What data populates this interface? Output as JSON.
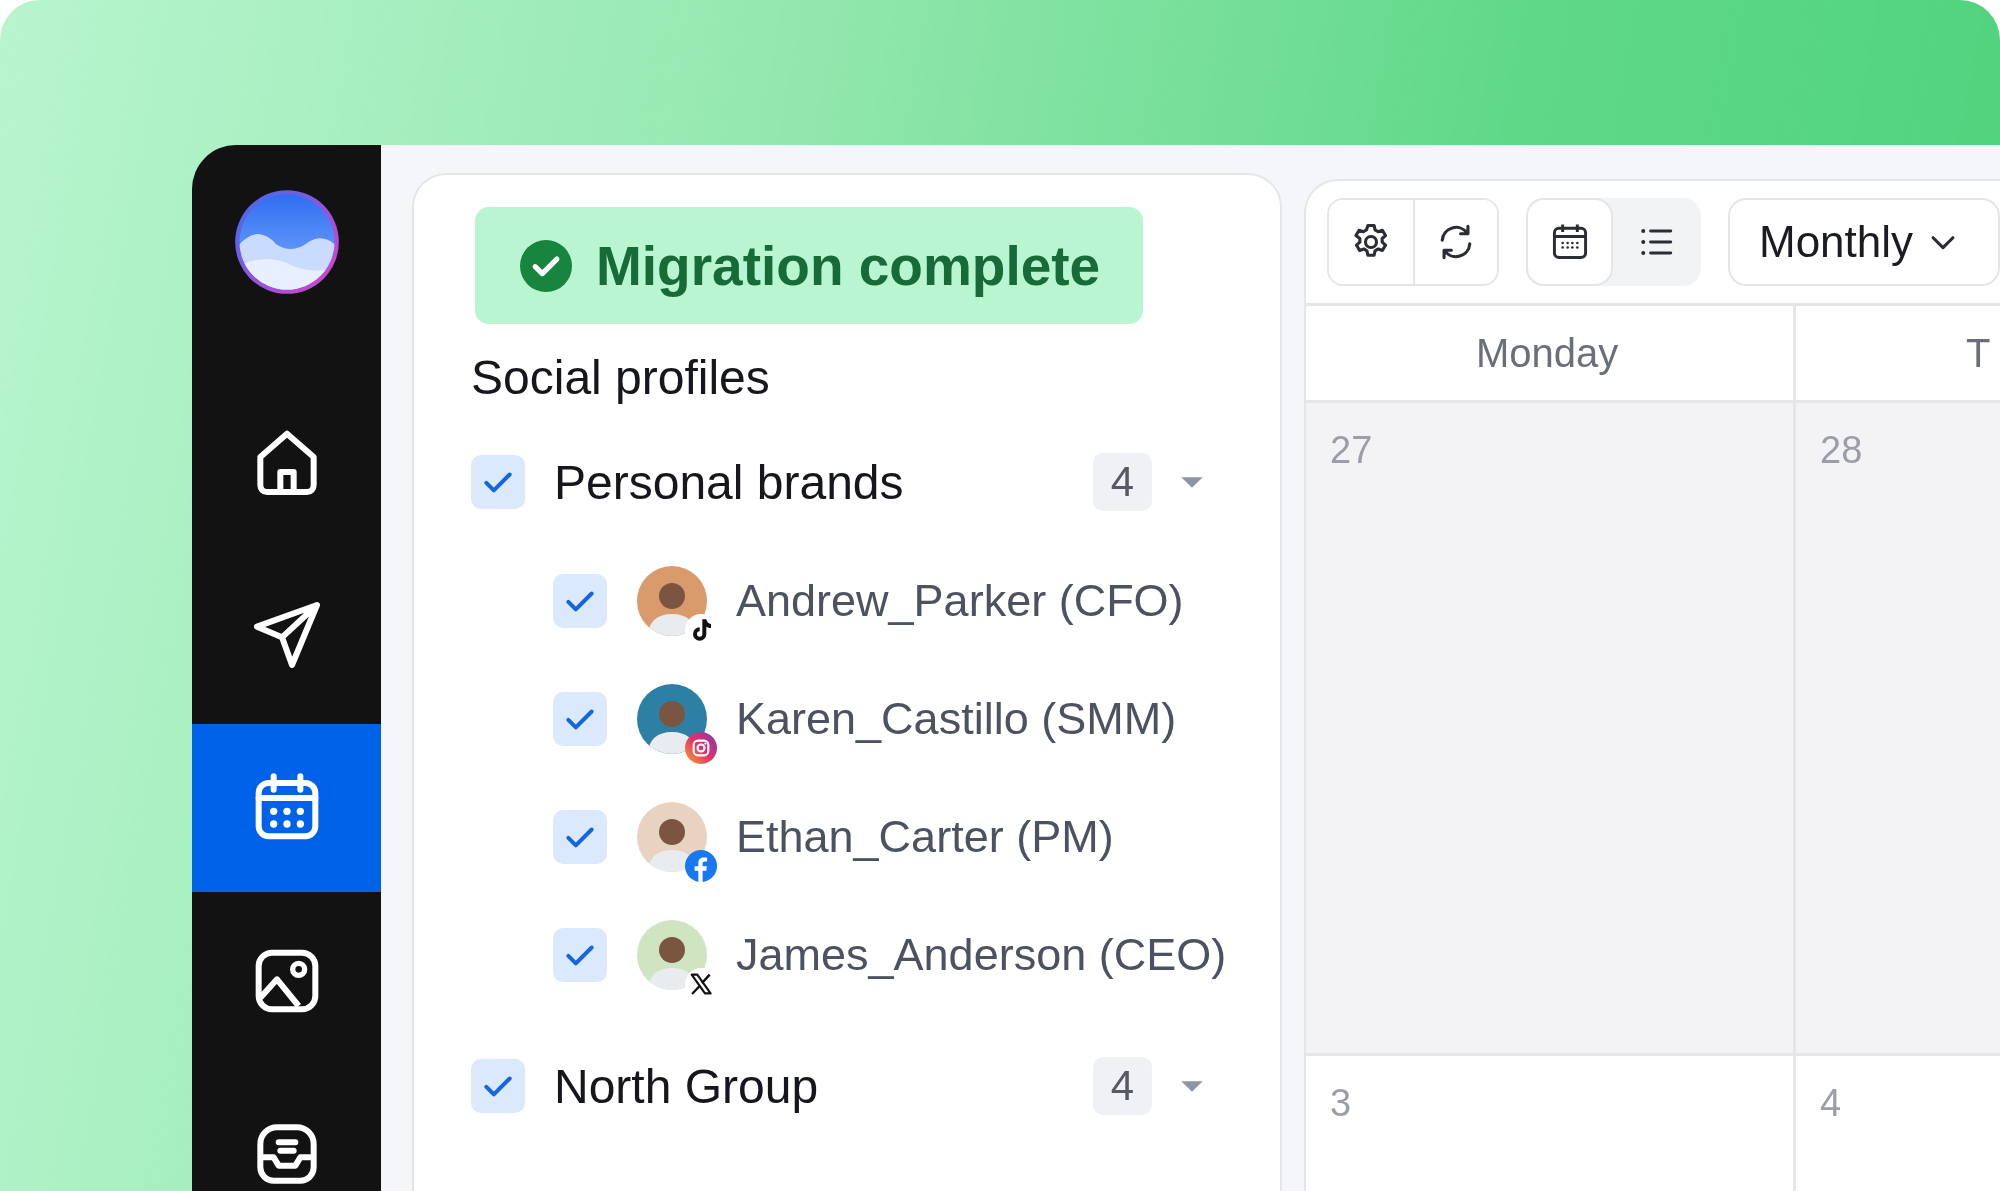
{
  "sidebar": {
    "items": [
      {
        "kind": "home",
        "selected": false
      },
      {
        "kind": "send",
        "selected": false
      },
      {
        "kind": "calendar",
        "selected": true
      },
      {
        "kind": "media",
        "selected": false
      },
      {
        "kind": "inbox",
        "selected": false
      }
    ]
  },
  "notice": {
    "text": "Migration complete"
  },
  "profiles": {
    "title": "Social profiles",
    "groups": [
      {
        "name": "Personal brands",
        "checked": true,
        "count": "4",
        "expanded": true,
        "children": [
          {
            "name": "Andrew_Parker (CFO)",
            "checked": true,
            "kind": "tiktok"
          },
          {
            "name": "Karen_Castillo (SMM)",
            "checked": true,
            "kind": "instagram"
          },
          {
            "name": "Ethan_Carter (PM)",
            "checked": true,
            "kind": "facebook"
          },
          {
            "name": "James_Anderson (CEO)",
            "checked": true,
            "kind": "x"
          }
        ]
      },
      {
        "name": "North Group",
        "checked": true,
        "count": "4",
        "expanded": true
      }
    ]
  },
  "toolbar": {
    "actions": [
      {
        "kind": "settings"
      },
      {
        "kind": "refresh"
      }
    ],
    "views": [
      {
        "kind": "calendar",
        "selected": true
      },
      {
        "kind": "list",
        "selected": false
      }
    ],
    "range": "Monthly"
  },
  "calendar": {
    "days": [
      "Monday",
      "T"
    ],
    "weeks": [
      {
        "shaded": true,
        "dates": [
          "27",
          "28"
        ]
      },
      {
        "shaded": false,
        "dates": [
          "3",
          "4"
        ]
      }
    ]
  }
}
